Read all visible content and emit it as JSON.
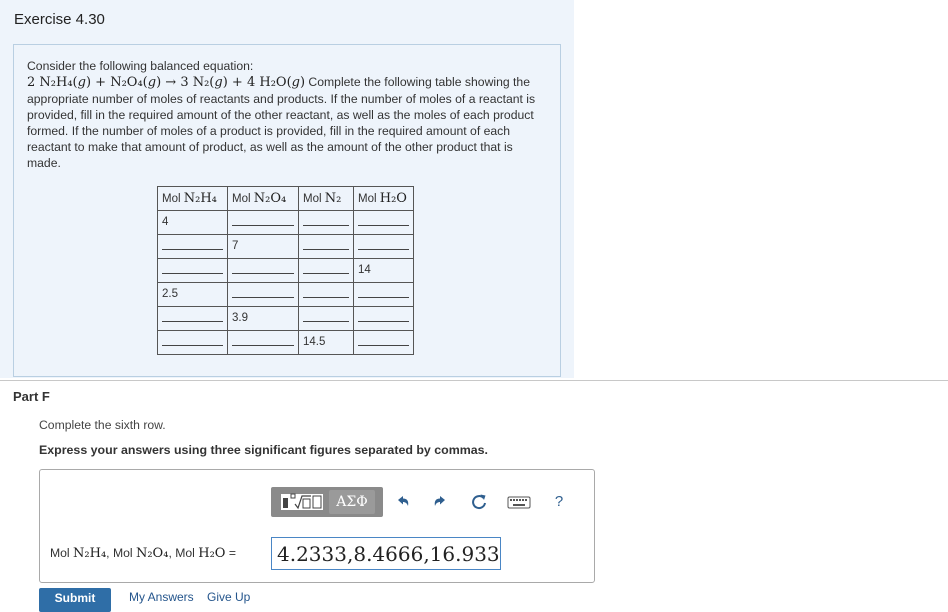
{
  "exercise": {
    "title": "Exercise 4.30"
  },
  "problem": {
    "intro": "Consider the following balanced equation:",
    "equation": {
      "r1": "2 N₂H₄(",
      "r1_state": "g",
      "r1_close": ")",
      "plus1": " + ",
      "r2": "N₂O₄(",
      "r2_state": "g",
      "r2_close": ")",
      "arrow": " → ",
      "p1": "3 N₂(",
      "p1_state": "g",
      "p1_close": ")",
      "plus2": " + ",
      "p2": "4 H₂O(",
      "p2_state": "g",
      "p2_close": ")"
    },
    "body": " Complete the following table showing the appropriate number of moles of reactants and products. If the number of moles of a reactant is provided, fill in the required amount of the other reactant, as well as the moles of each product formed. If the number of moles of a product is provided, fill in the required amount of each reactant to make that amount of product, as well as the amount of the other product that is made."
  },
  "table": {
    "headers": [
      {
        "prefix": "Mol ",
        "formula": "N₂H₄"
      },
      {
        "prefix": "Mol ",
        "formula": "N₂O₄"
      },
      {
        "prefix": "Mol ",
        "formula": "N₂"
      },
      {
        "prefix": "Mol ",
        "formula": "H₂O"
      }
    ],
    "rows": [
      [
        "4",
        "",
        "",
        ""
      ],
      [
        "",
        "7",
        "",
        ""
      ],
      [
        "",
        "",
        "",
        "14"
      ],
      [
        "2.5",
        "",
        "",
        ""
      ],
      [
        "",
        "3.9",
        "",
        ""
      ],
      [
        "",
        "",
        "14.5",
        ""
      ]
    ]
  },
  "part": {
    "label": "Part F",
    "instruction": "Complete the sixth row.",
    "express": "Express your answers using three significant figures separated by commas."
  },
  "toolbar": {
    "greek_label": "ΑΣΦ",
    "help_label": "?",
    "icons": [
      "templates-icon",
      "greek-letters-icon",
      "undo-icon",
      "redo-icon",
      "reset-icon",
      "keyboard-icon",
      "help-icon"
    ]
  },
  "answer": {
    "label_mol1": "Mol ",
    "label_f1": "N₂H₄",
    "label_sep1": ", Mol ",
    "label_f2": "N₂O₄",
    "label_sep2": ", Mol ",
    "label_f3": "H₂O",
    "label_eq": " =",
    "value": "4.2333,8.4666,16.933"
  },
  "actions": {
    "submit": "Submit",
    "my_answers": "My Answers",
    "give_up": "Give Up"
  },
  "colors": {
    "panel_bg": "#eef4fb",
    "panel_border": "#b9cfe2",
    "submit_bg": "#2f6ea7",
    "input_border": "#4a86c5",
    "link": "#24558c"
  }
}
